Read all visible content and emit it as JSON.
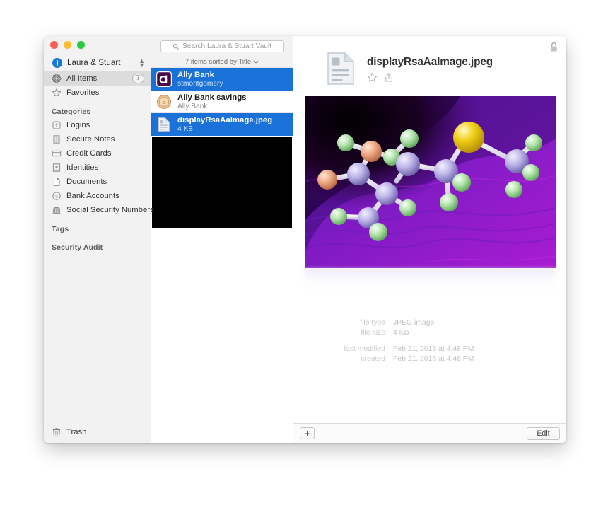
{
  "window": {
    "traffic_lights": [
      {
        "name": "close-button",
        "color": "#fc5f57"
      },
      {
        "name": "minimize-button",
        "color": "#fdbc2e"
      },
      {
        "name": "zoom-button",
        "color": "#2ac840"
      }
    ]
  },
  "sidebar": {
    "vault": {
      "name": "Laura & Stuart",
      "icon": "vault-badge-icon"
    },
    "top_items": [
      {
        "label": "All Items",
        "icon": "all-items-icon",
        "count": "7",
        "selected": true
      },
      {
        "label": "Favorites",
        "icon": "star-icon",
        "count": "",
        "selected": false
      }
    ],
    "categories_heading": "Categories",
    "categories": [
      {
        "label": "Logins",
        "icon": "login-icon"
      },
      {
        "label": "Secure Notes",
        "icon": "note-icon"
      },
      {
        "label": "Credit Cards",
        "icon": "credit-card-icon"
      },
      {
        "label": "Identities",
        "icon": "identity-icon"
      },
      {
        "label": "Documents",
        "icon": "document-icon"
      },
      {
        "label": "Bank Accounts",
        "icon": "bank-account-icon"
      },
      {
        "label": "Social Security Numbers",
        "icon": "ssn-icon"
      }
    ],
    "tags_heading": "Tags",
    "security_audit_heading": "Security Audit",
    "trash": {
      "label": "Trash",
      "icon": "trash-icon"
    }
  },
  "list": {
    "search": {
      "placeholder": "Search Laura & Stuart Vault",
      "value": "",
      "icon": "search-icon"
    },
    "sort_bar": {
      "text": "7 items sorted by Title",
      "chevron": "chevron-down-icon"
    },
    "items": [
      {
        "title": "Ally Bank",
        "subtitle": "stmontgomery",
        "icon": "ally-bank-logo-icon",
        "selected": true
      },
      {
        "title": "Ally Bank savings",
        "subtitle": "Ally Bank",
        "icon": "coin-icon",
        "selected": false
      },
      {
        "title": "displayRsaAaImage.jpeg",
        "subtitle": "4 KB",
        "icon": "document-file-icon",
        "selected": true
      }
    ]
  },
  "detail": {
    "lock_icon": "lock-icon",
    "file_icon": "document-file-large-icon",
    "title": "displayRsaAaImage.jpeg",
    "actions": [
      {
        "name": "favorite-star-icon",
        "label": ""
      },
      {
        "name": "share-icon",
        "label": ""
      }
    ],
    "preview": {
      "name": "molecule-image-preview",
      "alt": "molecule ball-and-stick render"
    },
    "metadata": [
      {
        "key": "file type",
        "value": "JPEG image",
        "gap": false
      },
      {
        "key": "file size",
        "value": "4 KB",
        "gap": false
      },
      {
        "key": "last modified",
        "value": "Feb 21, 2016 at 4:48 PM",
        "gap": true
      },
      {
        "key": "created",
        "value": "Feb 21, 2016 at 4:48 PM",
        "gap": false
      }
    ],
    "footer": {
      "add_label": "+",
      "edit_label": "Edit"
    }
  },
  "colors": {
    "selection_blue": "#1a71d8",
    "sidebar_bg": "#f2f2f2",
    "ally_purple": "#4a0a4a"
  }
}
